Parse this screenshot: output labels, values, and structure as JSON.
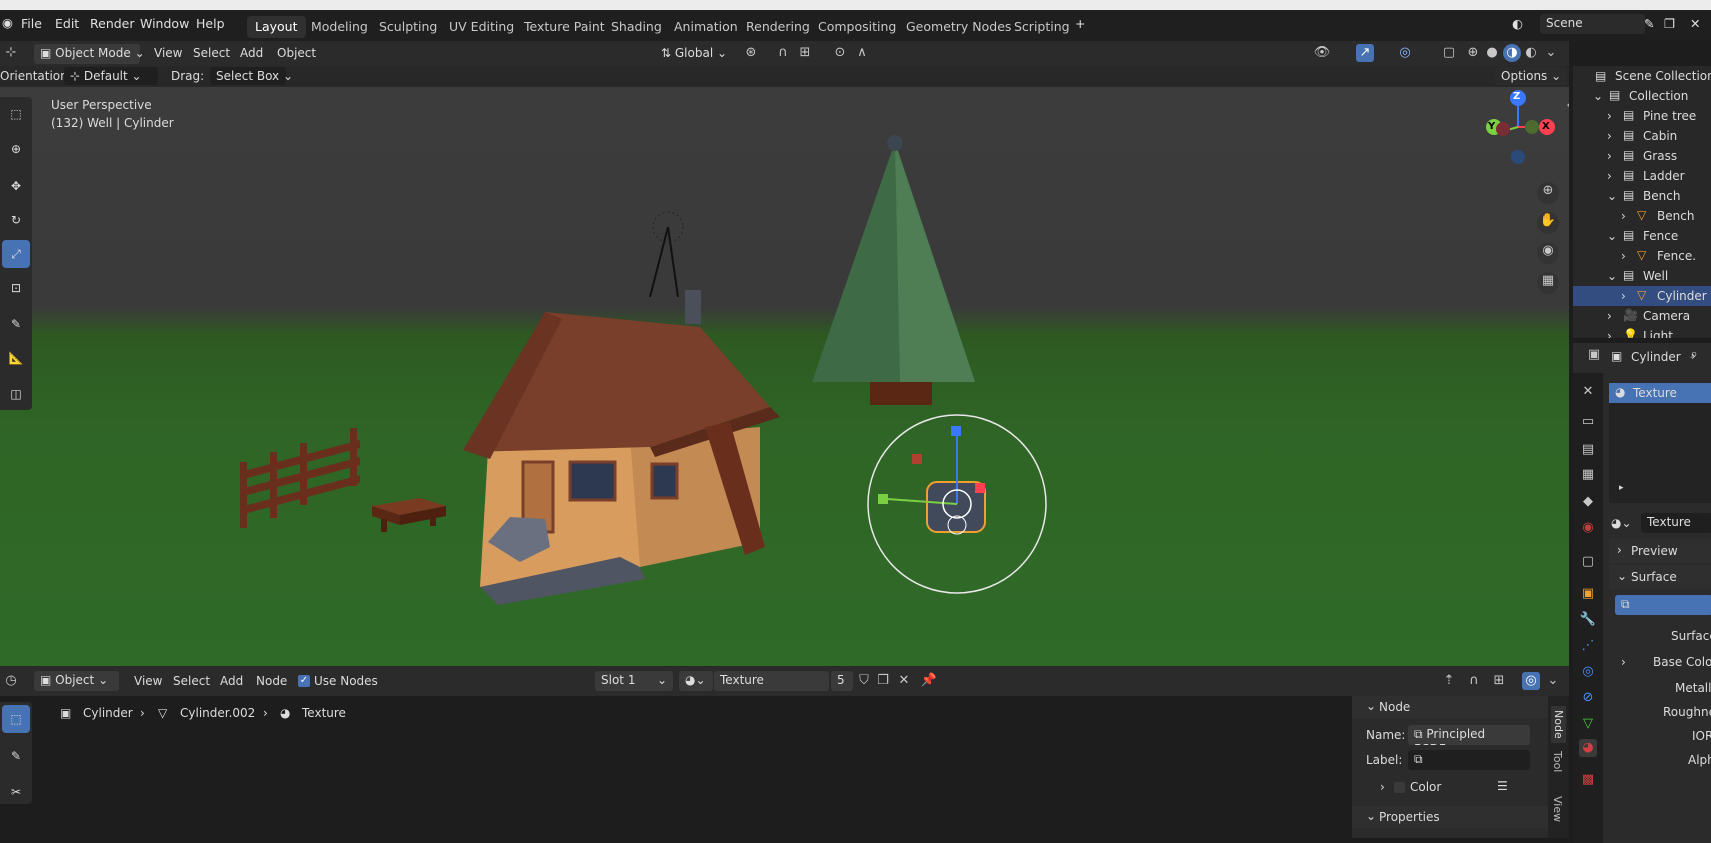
{
  "menubar": {
    "file": "File",
    "edit": "Edit",
    "render": "Render",
    "window": "Window",
    "help": "Help",
    "workspaces": [
      "Layout",
      "Modeling",
      "Sculpting",
      "UV Editing",
      "Texture Paint",
      "Shading",
      "Animation",
      "Rendering",
      "Compositing",
      "Geometry Nodes",
      "Scripting"
    ],
    "scene": "Scene"
  },
  "viewport_header": {
    "mode": "Object Mode",
    "view": "View",
    "select": "Select",
    "add": "Add",
    "object": "Object",
    "transform": "Global",
    "options": "Options",
    "orientation_label": "Orientation:",
    "orientation_value": "Default",
    "drag_label": "Drag:",
    "drag_value": "Select Box"
  },
  "viewport": {
    "perspective": "User Perspective",
    "object_info": "(132) Well | Cylinder",
    "gizmo_z": "Z",
    "gizmo_y": "Y",
    "gizmo_x": "X"
  },
  "outliner": {
    "scene_collection": "Scene Collection",
    "items": [
      {
        "label": "Collection",
        "indent": 1,
        "icon": "collection"
      },
      {
        "label": "Pine tree",
        "indent": 2,
        "icon": "collection"
      },
      {
        "label": "Cabin",
        "indent": 2,
        "icon": "collection"
      },
      {
        "label": "Grass",
        "indent": 2,
        "icon": "collection"
      },
      {
        "label": "Ladder",
        "indent": 2,
        "icon": "collection"
      },
      {
        "label": "Bench",
        "indent": 2,
        "icon": "collection"
      },
      {
        "label": "Bench",
        "indent": 3,
        "icon": "mesh"
      },
      {
        "label": "Fence",
        "indent": 2,
        "icon": "collection"
      },
      {
        "label": "Fence.",
        "indent": 3,
        "icon": "mesh"
      },
      {
        "label": "Well",
        "indent": 2,
        "icon": "collection"
      },
      {
        "label": "Cylinder",
        "indent": 3,
        "icon": "mesh",
        "selected": true
      },
      {
        "label": "Camera",
        "indent": 2,
        "icon": "camera"
      },
      {
        "label": "Light",
        "indent": 2,
        "icon": "light"
      }
    ]
  },
  "properties": {
    "object": "Cylinder",
    "material_slot": "Texture",
    "material": "Texture",
    "preview": "Preview",
    "surface": "Surface",
    "surface_label": "Surface",
    "base_color": "Base Color",
    "metallic": "Metallic",
    "roughness": "Roughness",
    "ior": "IOR",
    "alpha": "Alpha"
  },
  "node_editor": {
    "mode": "Object",
    "view": "View",
    "select": "Select",
    "add": "Add",
    "node": "Node",
    "use_nodes": "Use Nodes",
    "slot": "Slot 1",
    "material": "Texture",
    "users": "5",
    "breadcrumb": [
      "Cylinder",
      "Cylinder.002",
      "Texture"
    ]
  },
  "node_panel": {
    "node_header": "Node",
    "name_label": "Name:",
    "name_value": "Principled BSDF....",
    "label_label": "Label:",
    "color": "Color",
    "properties_header": "Properties",
    "tabs": [
      "Node",
      "Tool",
      "View"
    ]
  },
  "colors": {
    "accent": "#4772b3",
    "selected_row": "#334d80",
    "ground": "#2f6526"
  }
}
